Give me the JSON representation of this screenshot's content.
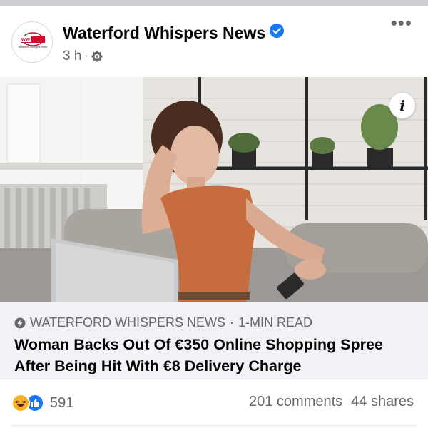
{
  "post": {
    "page_name": "Waterford Whispers News",
    "timestamp": "3 h",
    "separator": "·",
    "avatar_logo_text": "ww news",
    "avatar_sub_text": "Waterford Whispers News"
  },
  "link": {
    "source": "WATERFORD WHISPERS NEWS",
    "read_time": "1-MIN READ",
    "separator": "·",
    "headline": "Woman Backs Out Of €350 Online Shopping Spree After Being Hit With €8 Delivery Charge"
  },
  "stats": {
    "reaction_count": "591",
    "comments": "201 comments",
    "shares": "44 shares"
  },
  "icons": {
    "verified": "verified-badge-icon",
    "audience": "gear-icon",
    "more": "more-options-icon",
    "info": "info-icon",
    "source_bolt": "lightning-icon",
    "reactions": [
      "haha-reaction-icon",
      "like-reaction-icon"
    ]
  },
  "colors": {
    "facebook_blue": "#1877f2",
    "secondary_text": "#65676b",
    "link_background": "#f0f2f5",
    "logo_red": "#c8102e"
  }
}
